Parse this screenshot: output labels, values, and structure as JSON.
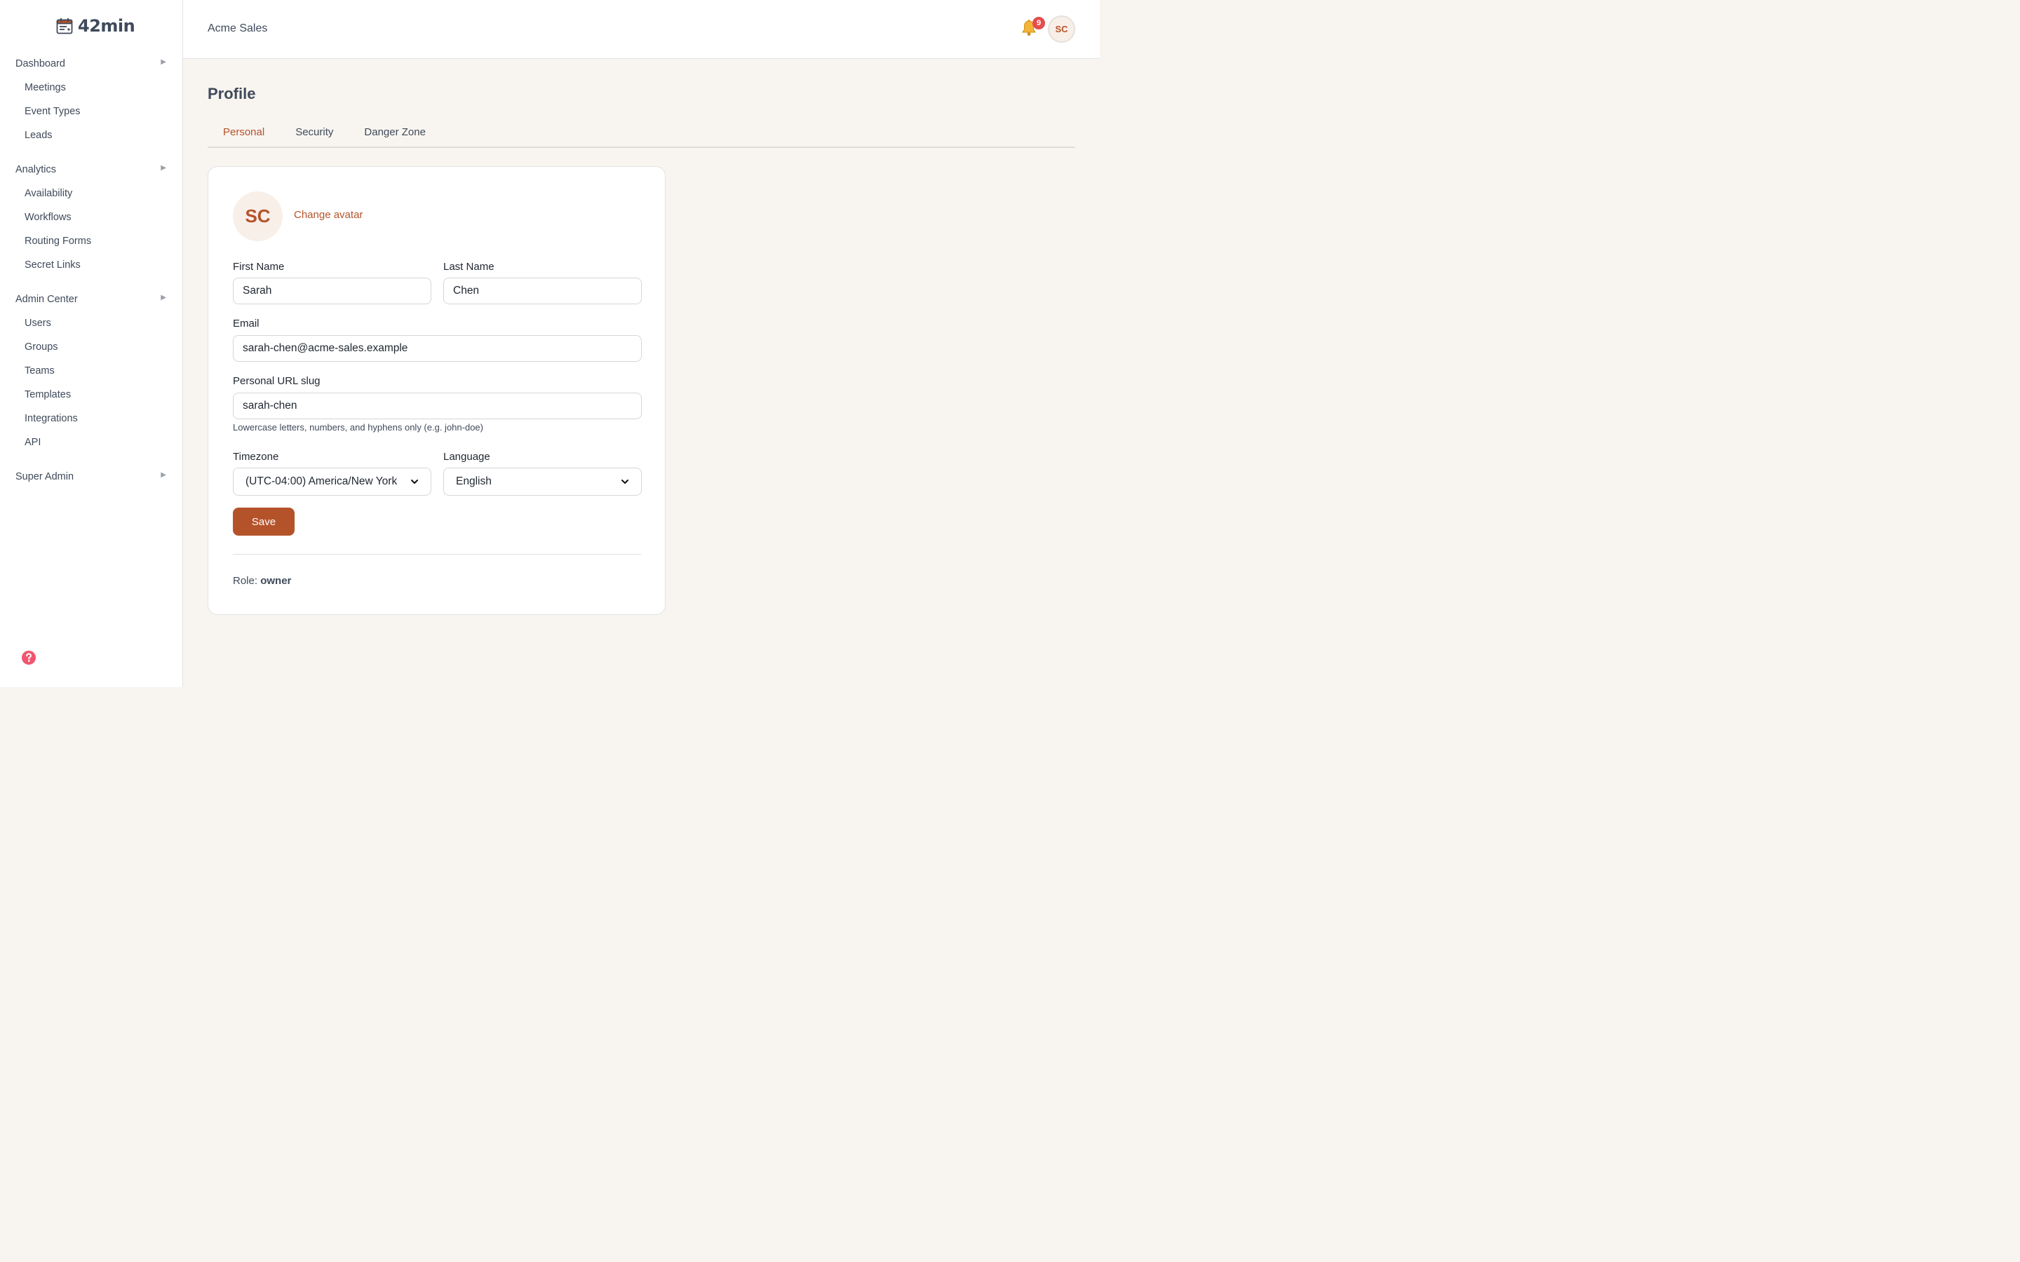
{
  "brand": {
    "name": "42min"
  },
  "sidebar": {
    "groups": [
      {
        "label": "Dashboard",
        "items": [
          "Meetings",
          "Event Types",
          "Leads"
        ]
      },
      {
        "label": "Analytics",
        "items": [
          "Availability",
          "Workflows",
          "Routing Forms",
          "Secret Links"
        ]
      },
      {
        "label": "Admin Center",
        "items": [
          "Users",
          "Groups",
          "Teams",
          "Templates",
          "Integrations",
          "API"
        ]
      },
      {
        "label": "Super Admin",
        "items": []
      }
    ]
  },
  "topbar": {
    "org_name": "Acme Sales",
    "notification_count": "9",
    "avatar_initials": "SC"
  },
  "page": {
    "title": "Profile",
    "tabs": [
      {
        "label": "Personal",
        "active": true
      },
      {
        "label": "Security",
        "active": false
      },
      {
        "label": "Danger Zone",
        "active": false
      }
    ]
  },
  "profile": {
    "avatar_initials": "SC",
    "change_avatar_label": "Change avatar",
    "first_name_label": "First Name",
    "first_name_value": "Sarah",
    "last_name_label": "Last Name",
    "last_name_value": "Chen",
    "email_label": "Email",
    "email_value": "sarah-chen@acme-sales.example",
    "slug_label": "Personal URL slug",
    "slug_value": "sarah-chen",
    "slug_hint": "Lowercase letters, numbers, and hyphens only (e.g. john-doe)",
    "timezone_label": "Timezone",
    "timezone_value": "(UTC-04:00) America/New York",
    "language_label": "Language",
    "language_value": "English",
    "save_label": "Save",
    "role_label": "Role:",
    "role_value": "owner"
  },
  "colors": {
    "accent": "#b4532a",
    "page_bg": "#f8f4f0",
    "badge": "#e44d4d"
  },
  "icons": {
    "brand": "calendar-icon",
    "group_caret": "caret-right-icon",
    "notifications": "bell-icon",
    "help": "help-circle-icon",
    "select": "chevron-down-icon"
  }
}
